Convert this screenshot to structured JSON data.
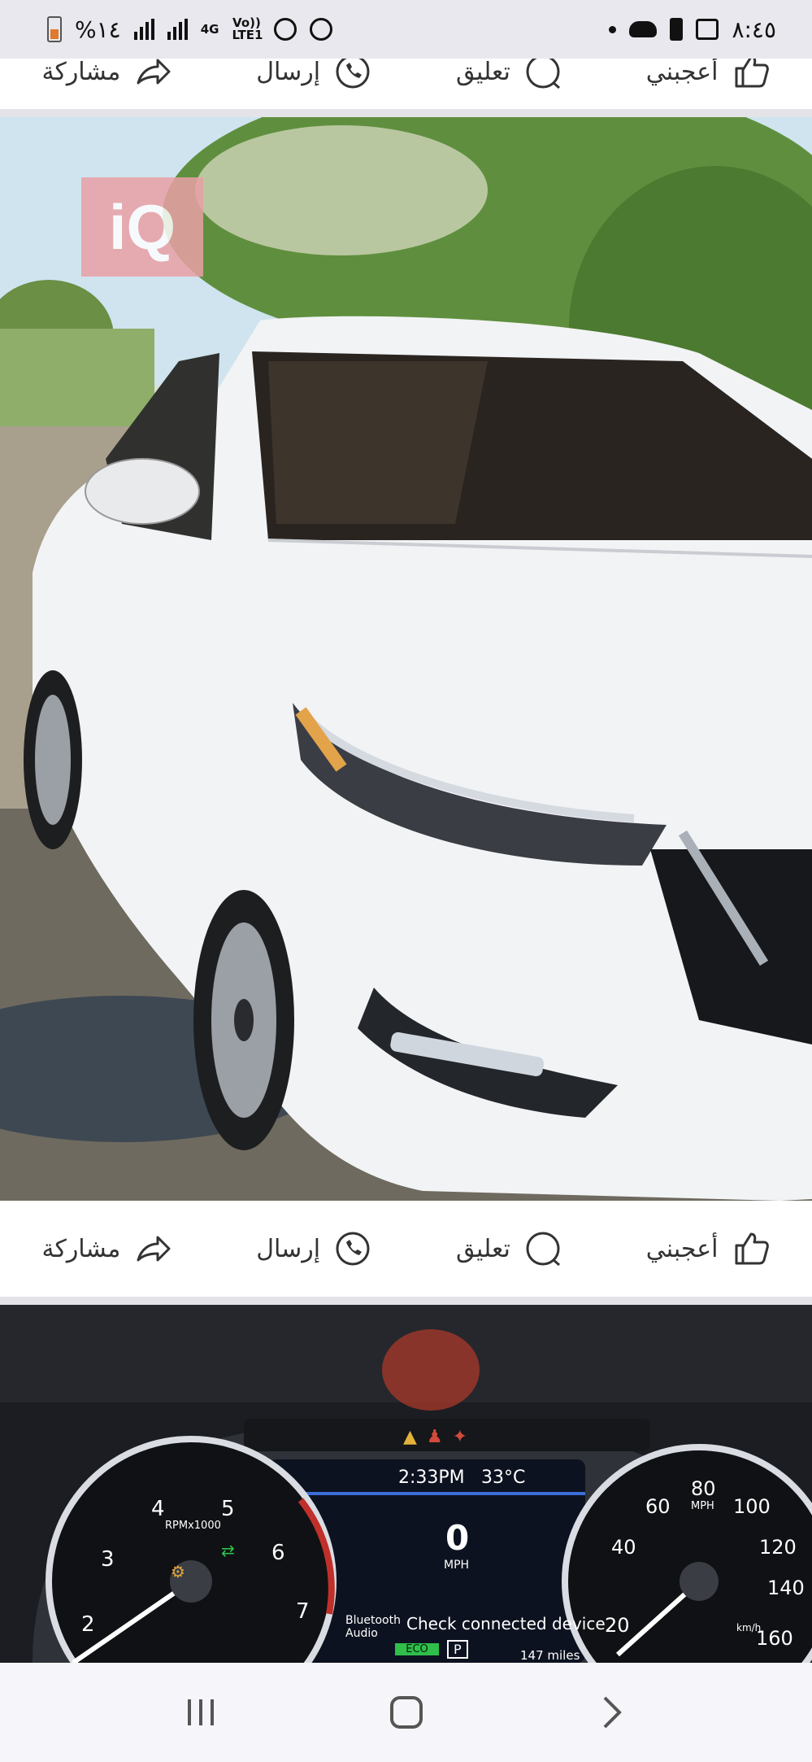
{
  "status_bar": {
    "time": "٨:٤٥",
    "battery": "%١٤",
    "network": "4G",
    "volte": "Vo)) LTE1"
  },
  "actions": {
    "like": "أعجبني",
    "comment": "تعليق",
    "send": "إرسال",
    "share": "مشاركة"
  },
  "car_photo": {
    "watermark": "iQ"
  },
  "dashboard": {
    "time": "2:33PM",
    "temperature": "33°C",
    "speed": "0",
    "speed_unit": "MPH",
    "rpm_label": "RPMx1000",
    "tach_numbers": [
      "2",
      "3",
      "4",
      "5",
      "6",
      "7"
    ],
    "speedo_numbers": [
      "20",
      "40",
      "60",
      "80",
      "100",
      "120",
      "140",
      "160"
    ],
    "bluetooth": "Bluetooth Audio",
    "message": "Check connected device",
    "eco": "ECO",
    "gear": "P",
    "odometer": "147 miles",
    "mph_small": "MPH",
    "kmh_small": "km/h"
  },
  "colors": {
    "accent_like": "#222222",
    "status_bg": "#e8e8ee",
    "car_white": "#f3f4f6",
    "watermark_bg": "#e9a0a6"
  }
}
